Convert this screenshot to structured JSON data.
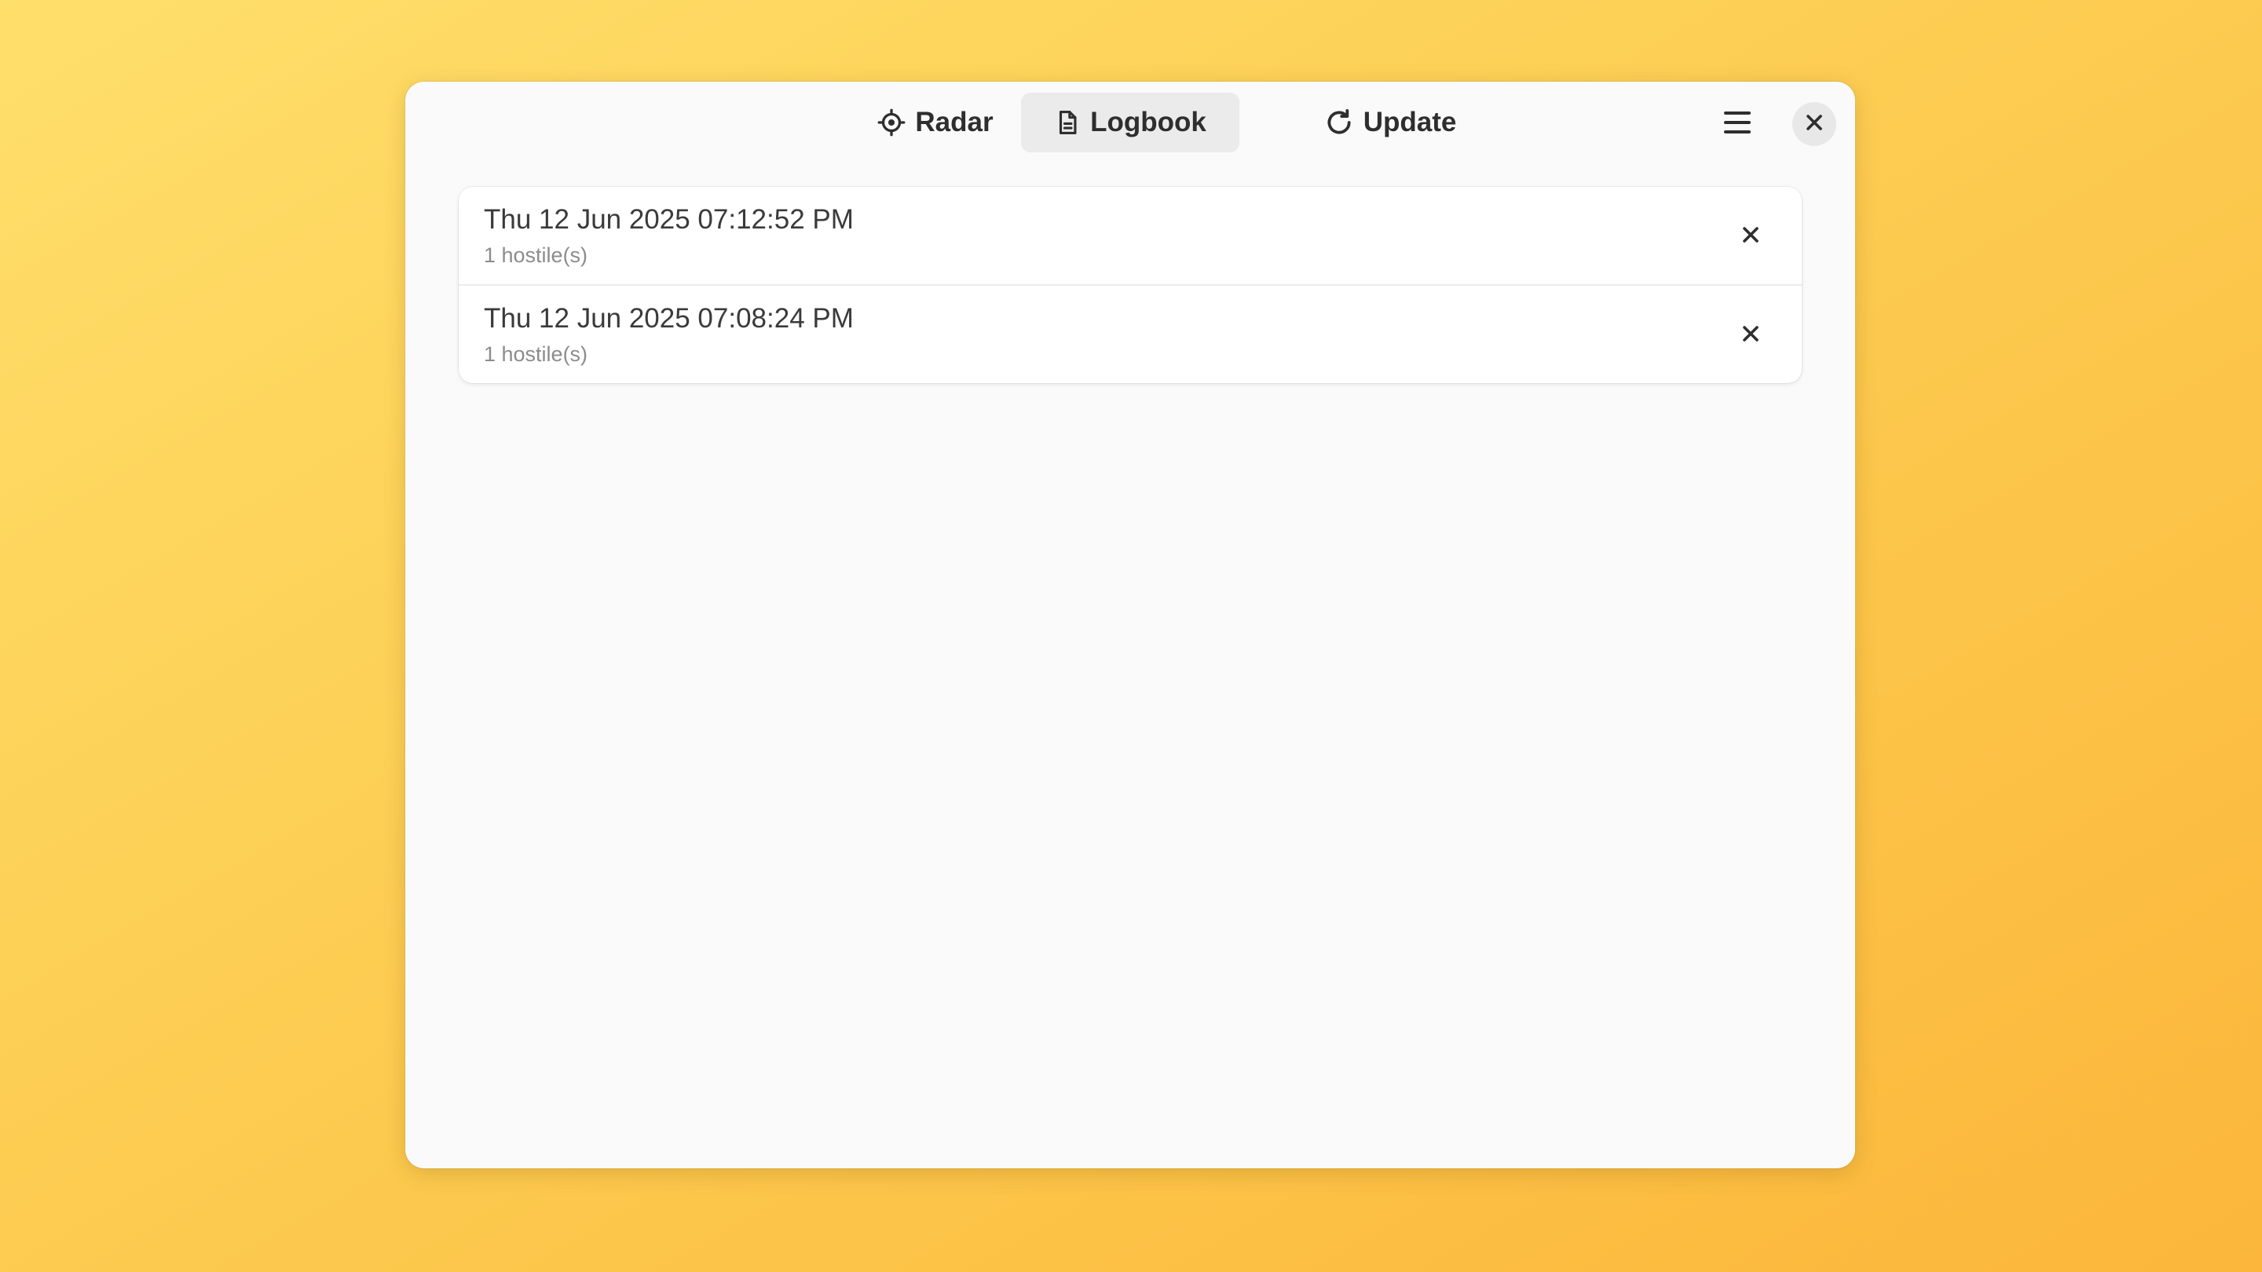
{
  "header": {
    "tabs": [
      {
        "label": "Radar",
        "icon": "crosshair-icon",
        "active": false
      },
      {
        "label": "Logbook",
        "icon": "document-icon",
        "active": true
      },
      {
        "label": "Update",
        "icon": "refresh-icon",
        "active": false
      }
    ],
    "menu_icon": "hamburger-menu-icon",
    "close_icon": "close-icon"
  },
  "logbook": {
    "entries": [
      {
        "timestamp": "Thu 12 Jun 2025 07:12:52 PM",
        "detail": "1 hostile(s)"
      },
      {
        "timestamp": "Thu 12 Jun 2025 07:08:24 PM",
        "detail": "1 hostile(s)"
      }
    ],
    "remove_icon": "remove-entry-icon"
  },
  "colors": {
    "background_top": "#ffdf6b",
    "background_bottom": "#fbb63b",
    "window": "#fafafa",
    "active_tab": "#ebebeb",
    "text": "#2e2e2e",
    "subtext": "#8c8c8c"
  }
}
